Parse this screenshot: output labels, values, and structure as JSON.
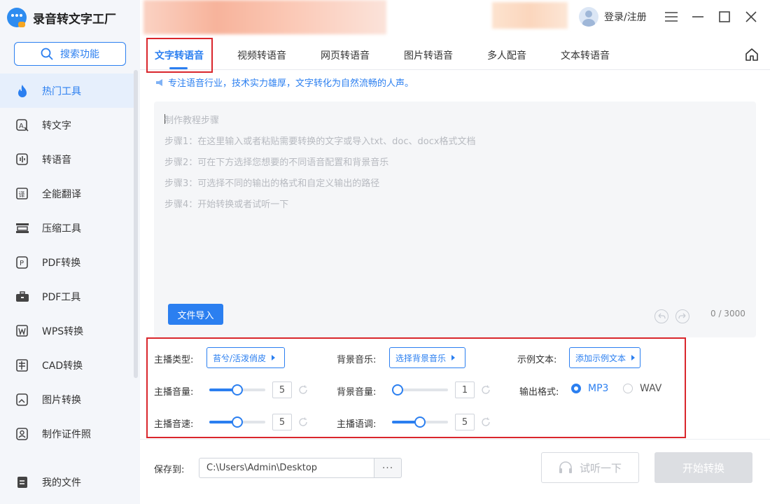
{
  "app": {
    "title": "录音转文字工厂"
  },
  "search": {
    "label": "搜索功能"
  },
  "sidebar": {
    "items": [
      {
        "label": "热门工具",
        "icon": "fire-icon",
        "active": true
      },
      {
        "label": "转文字",
        "icon": "text-convert-icon"
      },
      {
        "label": "转语音",
        "icon": "voice-icon"
      },
      {
        "label": "全能翻译",
        "icon": "translate-icon"
      },
      {
        "label": "压缩工具",
        "icon": "compress-icon"
      },
      {
        "label": "PDF转换",
        "icon": "pdf-convert-icon"
      },
      {
        "label": "PDF工具",
        "icon": "briefcase-icon"
      },
      {
        "label": "WPS转换",
        "icon": "wps-icon"
      },
      {
        "label": "CAD转换",
        "icon": "cad-icon"
      },
      {
        "label": "图片转换",
        "icon": "image-icon"
      },
      {
        "label": "制作证件照",
        "icon": "id-photo-icon"
      }
    ],
    "bottom": {
      "label": "我的文件",
      "icon": "file-icon"
    }
  },
  "header": {
    "login_label": "登录/注册"
  },
  "tabs": [
    {
      "label": "文字转语音",
      "active": true
    },
    {
      "label": "视频转语音"
    },
    {
      "label": "网页转语音"
    },
    {
      "label": "图片转语音"
    },
    {
      "label": "多人配音"
    },
    {
      "label": "文本转语音"
    }
  ],
  "tagline": "专注语音行业，技术实力雄厚，文字转化为自然流畅的人声。",
  "editor": {
    "heading": "制作教程步骤",
    "steps": [
      "步骤1：在这里输入或者粘贴需要转换的文字或导入txt、doc、docx格式文档",
      "步骤2：可在下方选择您想要的不同语音配置和背景音乐",
      "步骤3：可选择不同的输出的格式和自定义输出的路径",
      "步骤4：开始转换或者试听一下"
    ],
    "import_label": "文件导入",
    "counter": "0 / 3000"
  },
  "settings": {
    "anchor_type": {
      "label": "主播类型:",
      "value": "苔兮/活泼俏皮"
    },
    "bg_music": {
      "label": "背景音乐:",
      "value": "选择背景音乐"
    },
    "sample_text": {
      "label": "示例文本:",
      "value": "添加示例文本"
    },
    "anchor_volume": {
      "label": "主播音量:",
      "value": "5",
      "level": 0.5
    },
    "bg_volume": {
      "label": "背景音量:",
      "value": "1",
      "level": 0.0
    },
    "anchor_speed": {
      "label": "主播音速:",
      "value": "5",
      "level": 0.5
    },
    "anchor_pitch": {
      "label": "主播语调:",
      "value": "5",
      "level": 0.5
    },
    "output_format": {
      "label": "输出格式:",
      "options": [
        "MP3",
        "WAV"
      ],
      "selected": "MP3"
    }
  },
  "footer": {
    "save_label": "保存到:",
    "save_path": "C:\\Users\\Admin\\Desktop",
    "browse_label": "···",
    "listen_label": "试听一下",
    "start_label": "开始转换"
  },
  "colors": {
    "accent": "#2b7ff0",
    "highlight_box": "#d9262c"
  }
}
